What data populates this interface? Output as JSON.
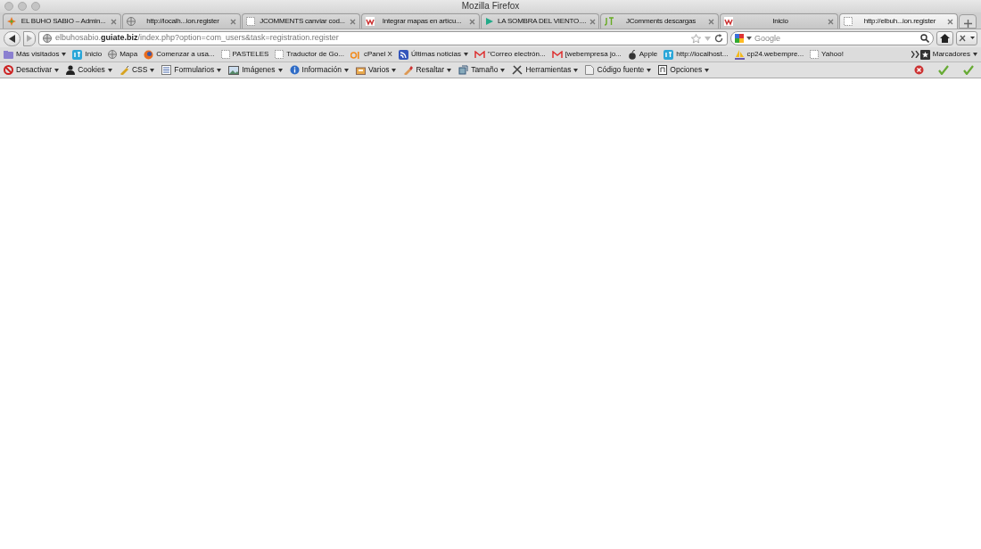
{
  "window": {
    "title": "Mozilla Firefox"
  },
  "tabs": [
    {
      "label": "EL BUHO SABIO – Admin...",
      "selected": false
    },
    {
      "label": "http://localh...ion.register",
      "selected": false
    },
    {
      "label": "JCOMMENTS canviar cod...",
      "selected": false
    },
    {
      "label": "Integrar mapas en artícu...",
      "selected": false
    },
    {
      "label": "LA SOMBRA DEL VIENTO....",
      "selected": false
    },
    {
      "label": "JComments descargas",
      "selected": false
    },
    {
      "label": "Inicio",
      "selected": false
    },
    {
      "label": "http://elbuh...ion.register",
      "selected": true
    }
  ],
  "address_bar": {
    "url": "elbuhosabio.**guiate.biz**/index.php?option=com_users&task=registration.register"
  },
  "search": {
    "placeholder": "Google"
  },
  "bookmarks": [
    {
      "label": "Más visitados",
      "dropdown": true
    },
    {
      "label": "Inicio",
      "dropdown": false
    },
    {
      "label": "Mapa",
      "dropdown": false
    },
    {
      "label": "Comenzar a usa...",
      "dropdown": false
    },
    {
      "label": "PASTELES",
      "dropdown": false
    },
    {
      "label": "Traductor de Go...",
      "dropdown": false
    },
    {
      "label": "cPanel X",
      "dropdown": false
    },
    {
      "label": "Últimas noticias",
      "dropdown": true
    },
    {
      "label": "\"Correo electrón...",
      "dropdown": false
    },
    {
      "label": "[webempresa jo...",
      "dropdown": false
    },
    {
      "label": "Apple",
      "dropdown": false
    },
    {
      "label": "http://localhost...",
      "dropdown": false
    },
    {
      "label": "cp24.webempre...",
      "dropdown": false
    },
    {
      "label": "Yahoo!",
      "dropdown": false
    }
  ],
  "bookmarks_menu": {
    "label": "Marcadores"
  },
  "developer_toolbar": [
    {
      "label": "Desactivar"
    },
    {
      "label": "Cookies"
    },
    {
      "label": "CSS"
    },
    {
      "label": "Formularios"
    },
    {
      "label": "Imágenes"
    },
    {
      "label": "Información"
    },
    {
      "label": "Varios"
    },
    {
      "label": "Resaltar"
    },
    {
      "label": "Tamaño"
    },
    {
      "label": "Herramientas"
    },
    {
      "label": "Código fuente"
    },
    {
      "label": "Opciones"
    }
  ]
}
